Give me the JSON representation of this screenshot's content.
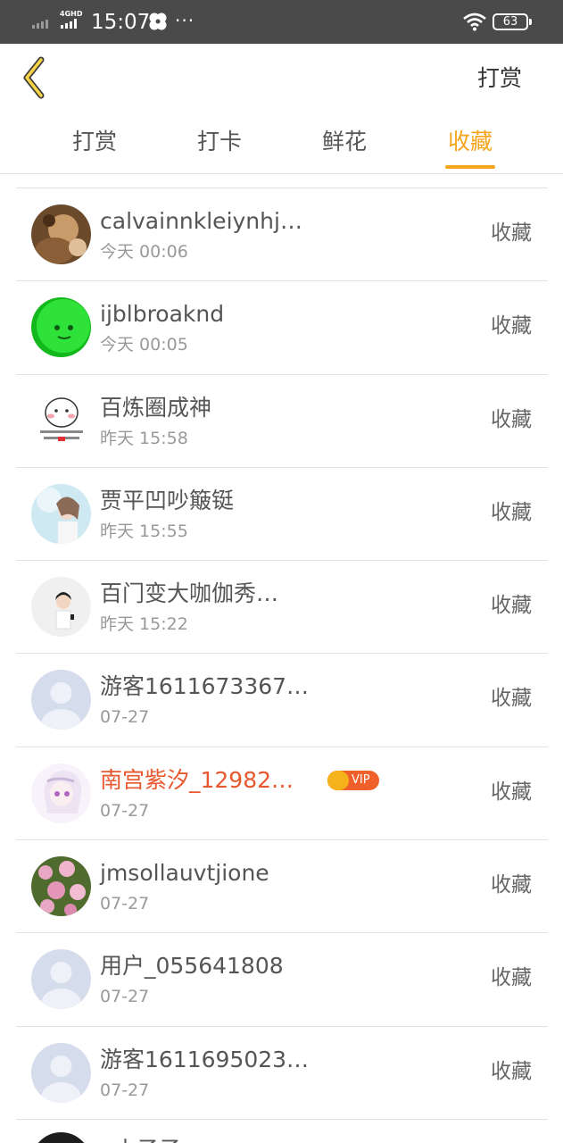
{
  "status_bar": {
    "network": "4GHD",
    "time": "15:07",
    "more": "···",
    "battery": "63"
  },
  "nav": {
    "action": "打赏"
  },
  "tabs": [
    {
      "label": "打赏",
      "active": false
    },
    {
      "label": "打卡",
      "active": false
    },
    {
      "label": "鲜花",
      "active": false
    },
    {
      "label": "收藏",
      "active": true
    }
  ],
  "list": [
    {
      "name": "calvainnkleiynhj…",
      "time": "今天 00:06",
      "action": "收藏",
      "avatar": "photo-avatar-brown"
    },
    {
      "name": "ijblbroaknd",
      "time": "今天 00:05",
      "action": "收藏",
      "avatar": "green-smiley-avatar"
    },
    {
      "name": "百炼圈成神",
      "time": "昨天 15:58",
      "action": "收藏",
      "avatar": "cartoon-avatar"
    },
    {
      "name": "贾平凹吵簸铤",
      "time": "昨天 15:55",
      "action": "收藏",
      "avatar": "photo-avatar-light"
    },
    {
      "name": "百门变大咖伽秀…",
      "time": "昨天 15:22",
      "action": "收藏",
      "avatar": "photo-avatar-person"
    },
    {
      "name": "游客1611673367…",
      "time": "07-27",
      "action": "收藏",
      "avatar": "default-avatar"
    },
    {
      "name": "南宫紫汐_12982…",
      "time": "07-27",
      "action": "收藏",
      "avatar": "anime-avatar",
      "vip": "VIP"
    },
    {
      "name": "jmsollauvtjione",
      "time": "07-27",
      "action": "收藏",
      "avatar": "flower-avatar"
    },
    {
      "name": "用户_055641808",
      "time": "07-27",
      "action": "收藏",
      "avatar": "default-avatar"
    },
    {
      "name": "游客1611695023…",
      "time": "07-27",
      "action": "收藏",
      "avatar": "default-avatar"
    }
  ],
  "partial_row": {
    "name": "··小子子"
  },
  "colors": {
    "accent": "#f5a41c",
    "vip_name": "#e8582e",
    "vip_badge": "#f0602b",
    "status_bar": "#4a4a4a"
  }
}
